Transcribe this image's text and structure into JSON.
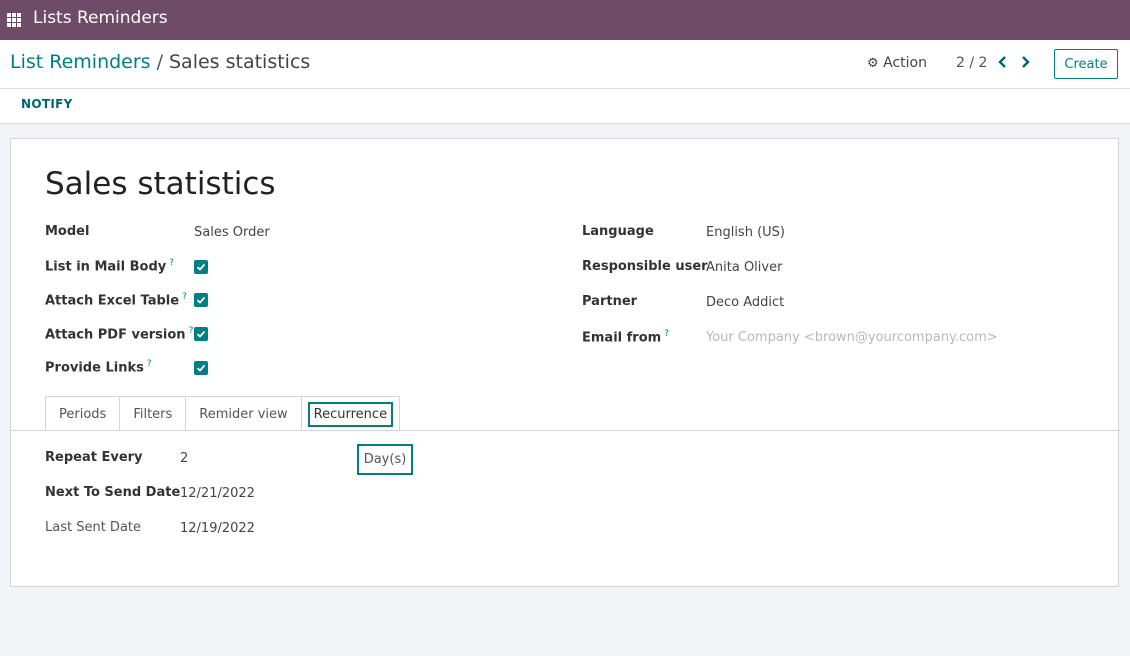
{
  "topbar": {
    "app_title": "Lists Reminders"
  },
  "breadcrumb": {
    "parent": "List Reminders",
    "separator": "/",
    "current": "Sales statistics"
  },
  "toolbar": {
    "action_label": "Action",
    "pager": "2 / 2",
    "create_label": "Create",
    "notify_label": "NOTIFY"
  },
  "record": {
    "title": "Sales statistics",
    "left_fields": {
      "model_label": "Model",
      "model_value": "Sales Order",
      "list_in_mail_body_label": "List in Mail Body",
      "list_in_mail_body_checked": true,
      "attach_excel_label": "Attach Excel Table",
      "attach_excel_checked": true,
      "attach_pdf_label": "Attach PDF version",
      "attach_pdf_checked": true,
      "provide_links_label": "Provide Links",
      "provide_links_checked": true,
      "help_mark": "?"
    },
    "right_fields": {
      "language_label": "Language",
      "language_value": "English (US)",
      "responsible_label": "Responsible user",
      "responsible_value": "Anita Oliver",
      "partner_label": "Partner",
      "partner_value": "Deco Addict",
      "email_from_label": "Email from",
      "email_from_placeholder": "Your Company <brown@yourcompany.com>"
    }
  },
  "tabs": [
    {
      "label": "Periods",
      "active": false
    },
    {
      "label": "Filters",
      "active": false
    },
    {
      "label": "Remider view",
      "active": false
    },
    {
      "label": "Recurrence",
      "active": true
    }
  ],
  "recurrence": {
    "repeat_every_label": "Repeat Every",
    "repeat_every_value": "2",
    "repeat_unit": "Day(s)",
    "next_send_label": "Next To Send Date",
    "next_send_value": "12/21/2022",
    "last_sent_label": "Last Sent Date",
    "last_sent_value": "12/19/2022"
  },
  "colors": {
    "topbar": "#6e4b67",
    "accent": "#017e84",
    "background": "#f3f4f7"
  }
}
